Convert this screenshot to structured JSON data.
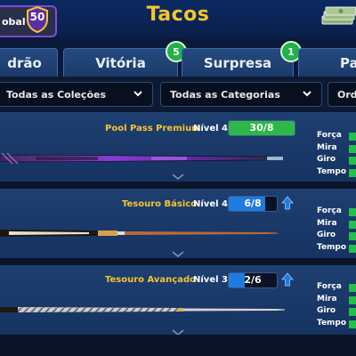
{
  "header": {
    "global_label": "obal",
    "global_rank": "50",
    "title": "Tacos",
    "cash_icon": "cash-stack-icon"
  },
  "tabs": [
    {
      "label": "drão",
      "badge": ""
    },
    {
      "label": "Vitória",
      "badge": "5"
    },
    {
      "label": "Surpresa",
      "badge": "1"
    },
    {
      "label": "Pa",
      "badge": ""
    }
  ],
  "filters": {
    "collections": "Todas as Coleções",
    "categories": "Todas as Categorias",
    "order": "Ord"
  },
  "cues": [
    {
      "name": "Pool Pass Premium",
      "level": "Nível 4",
      "progress_text": "30/8",
      "progress_fraction": 1.0,
      "progress_color": "#2fb84a",
      "has_arrow": false
    },
    {
      "name": "Tesouro Básico",
      "level": "Nível 4",
      "progress_text": "6/8",
      "progress_fraction": 0.75,
      "progress_color": "#1e7be0",
      "has_arrow": true
    },
    {
      "name": "Tesouro Avançado",
      "level": "Nível 3",
      "progress_text": "2/6",
      "progress_fraction": 0.33,
      "progress_color": "#1e7be0",
      "has_arrow": true
    }
  ],
  "stat_labels": [
    "Força",
    "Mira",
    "Giro",
    "Tempo"
  ],
  "colors": {
    "title": "#f3c62d",
    "badge_green": "#22b14c",
    "stat_green": "#22c04a",
    "upgrade_blue": "#1e7be0",
    "row_blue": "#1e3f71"
  }
}
